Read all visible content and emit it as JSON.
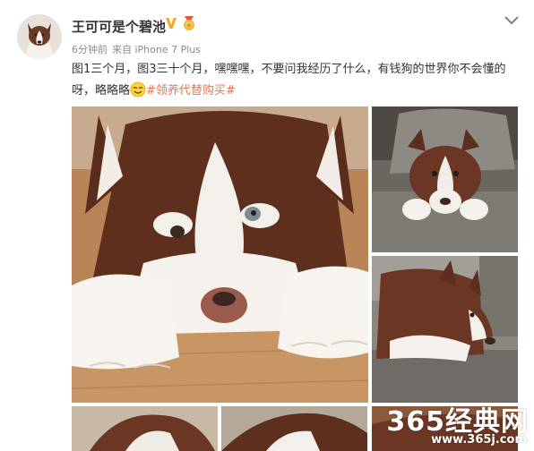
{
  "post": {
    "username": "王可可是个碧池",
    "meta": {
      "time": "6分钟前",
      "source": "来自 iPhone 7 Plus"
    },
    "content": {
      "text": "图1三个月，图3三十个月，嘿嘿嘿，不要问我经历了什么，有钱狗的世界你不会懂的呀，略略略",
      "emoji": "smile-emoji",
      "tag": "#领养代替购买#"
    },
    "icons": {
      "verified": "verified-v-icon",
      "medal": "medal-icon",
      "menu": "chevron-down-icon"
    },
    "colors": {
      "tag": "#eb7350",
      "verified": "#f5a623",
      "name": "#333333",
      "meta": "#8a8a8a"
    }
  },
  "watermark": {
    "main": "365经典网",
    "sub": "www.365j.com"
  }
}
